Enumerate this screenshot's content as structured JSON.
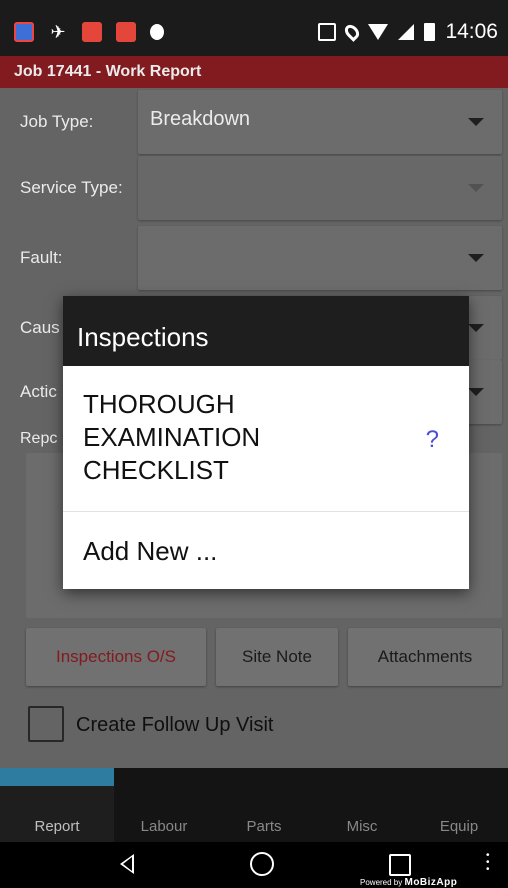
{
  "status_bar": {
    "time": "14:06",
    "left_icons": [
      "app-icon-1",
      "app-icon-2",
      "app-icon-3",
      "app-icon-4",
      "app-icon-5"
    ],
    "right_icons": [
      "cast-icon",
      "location-icon",
      "wifi-icon",
      "signal-icon",
      "battery-icon"
    ]
  },
  "app_bar": {
    "title": "Job 17441 - Work Report",
    "color": "#8e1e22"
  },
  "form": {
    "job_type": {
      "label": "Job Type:",
      "value": "Breakdown"
    },
    "service_type": {
      "label": "Service Type:",
      "value": ""
    },
    "fault": {
      "label": "Fault:",
      "value": ""
    },
    "cause": {
      "label": "Caus",
      "value": ""
    },
    "action": {
      "label": "Actic",
      "value": ""
    },
    "report": {
      "label": "Repc"
    }
  },
  "buttons": {
    "inspections": "Inspections O/S",
    "site_note": "Site Note",
    "attachments": "Attachments"
  },
  "follow_up": {
    "label": "Create Follow Up Visit",
    "checked": false
  },
  "dialog": {
    "title": "Inspections",
    "items": [
      {
        "label": "THOROUGH EXAMINATION CHECKLIST",
        "badge": "?"
      },
      {
        "label": "Add New ..."
      }
    ]
  },
  "tabs": [
    {
      "label": "Report",
      "active": true
    },
    {
      "label": "Labour",
      "active": false
    },
    {
      "label": "Parts",
      "active": false
    },
    {
      "label": "Misc",
      "active": false
    },
    {
      "label": "Equip",
      "active": false
    }
  ],
  "nav_bar": {
    "powered_by": "Powered by",
    "brand": "MoBizApp"
  }
}
